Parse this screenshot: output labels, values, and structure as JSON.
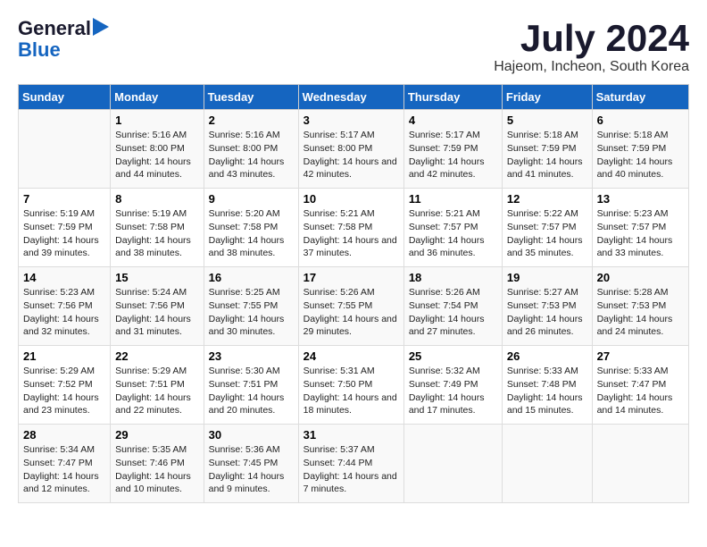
{
  "logo": {
    "line1": "General",
    "line2": "Blue"
  },
  "title": "July 2024",
  "subtitle": "Hajeom, Incheon, South Korea",
  "headers": [
    "Sunday",
    "Monday",
    "Tuesday",
    "Wednesday",
    "Thursday",
    "Friday",
    "Saturday"
  ],
  "weeks": [
    [
      {
        "day": "",
        "sunrise": "",
        "sunset": "",
        "daylight": ""
      },
      {
        "day": "1",
        "sunrise": "Sunrise: 5:16 AM",
        "sunset": "Sunset: 8:00 PM",
        "daylight": "Daylight: 14 hours and 44 minutes."
      },
      {
        "day": "2",
        "sunrise": "Sunrise: 5:16 AM",
        "sunset": "Sunset: 8:00 PM",
        "daylight": "Daylight: 14 hours and 43 minutes."
      },
      {
        "day": "3",
        "sunrise": "Sunrise: 5:17 AM",
        "sunset": "Sunset: 8:00 PM",
        "daylight": "Daylight: 14 hours and 42 minutes."
      },
      {
        "day": "4",
        "sunrise": "Sunrise: 5:17 AM",
        "sunset": "Sunset: 7:59 PM",
        "daylight": "Daylight: 14 hours and 42 minutes."
      },
      {
        "day": "5",
        "sunrise": "Sunrise: 5:18 AM",
        "sunset": "Sunset: 7:59 PM",
        "daylight": "Daylight: 14 hours and 41 minutes."
      },
      {
        "day": "6",
        "sunrise": "Sunrise: 5:18 AM",
        "sunset": "Sunset: 7:59 PM",
        "daylight": "Daylight: 14 hours and 40 minutes."
      }
    ],
    [
      {
        "day": "7",
        "sunrise": "Sunrise: 5:19 AM",
        "sunset": "Sunset: 7:59 PM",
        "daylight": "Daylight: 14 hours and 39 minutes."
      },
      {
        "day": "8",
        "sunrise": "Sunrise: 5:19 AM",
        "sunset": "Sunset: 7:58 PM",
        "daylight": "Daylight: 14 hours and 38 minutes."
      },
      {
        "day": "9",
        "sunrise": "Sunrise: 5:20 AM",
        "sunset": "Sunset: 7:58 PM",
        "daylight": "Daylight: 14 hours and 38 minutes."
      },
      {
        "day": "10",
        "sunrise": "Sunrise: 5:21 AM",
        "sunset": "Sunset: 7:58 PM",
        "daylight": "Daylight: 14 hours and 37 minutes."
      },
      {
        "day": "11",
        "sunrise": "Sunrise: 5:21 AM",
        "sunset": "Sunset: 7:57 PM",
        "daylight": "Daylight: 14 hours and 36 minutes."
      },
      {
        "day": "12",
        "sunrise": "Sunrise: 5:22 AM",
        "sunset": "Sunset: 7:57 PM",
        "daylight": "Daylight: 14 hours and 35 minutes."
      },
      {
        "day": "13",
        "sunrise": "Sunrise: 5:23 AM",
        "sunset": "Sunset: 7:57 PM",
        "daylight": "Daylight: 14 hours and 33 minutes."
      }
    ],
    [
      {
        "day": "14",
        "sunrise": "Sunrise: 5:23 AM",
        "sunset": "Sunset: 7:56 PM",
        "daylight": "Daylight: 14 hours and 32 minutes."
      },
      {
        "day": "15",
        "sunrise": "Sunrise: 5:24 AM",
        "sunset": "Sunset: 7:56 PM",
        "daylight": "Daylight: 14 hours and 31 minutes."
      },
      {
        "day": "16",
        "sunrise": "Sunrise: 5:25 AM",
        "sunset": "Sunset: 7:55 PM",
        "daylight": "Daylight: 14 hours and 30 minutes."
      },
      {
        "day": "17",
        "sunrise": "Sunrise: 5:26 AM",
        "sunset": "Sunset: 7:55 PM",
        "daylight": "Daylight: 14 hours and 29 minutes."
      },
      {
        "day": "18",
        "sunrise": "Sunrise: 5:26 AM",
        "sunset": "Sunset: 7:54 PM",
        "daylight": "Daylight: 14 hours and 27 minutes."
      },
      {
        "day": "19",
        "sunrise": "Sunrise: 5:27 AM",
        "sunset": "Sunset: 7:53 PM",
        "daylight": "Daylight: 14 hours and 26 minutes."
      },
      {
        "day": "20",
        "sunrise": "Sunrise: 5:28 AM",
        "sunset": "Sunset: 7:53 PM",
        "daylight": "Daylight: 14 hours and 24 minutes."
      }
    ],
    [
      {
        "day": "21",
        "sunrise": "Sunrise: 5:29 AM",
        "sunset": "Sunset: 7:52 PM",
        "daylight": "Daylight: 14 hours and 23 minutes."
      },
      {
        "day": "22",
        "sunrise": "Sunrise: 5:29 AM",
        "sunset": "Sunset: 7:51 PM",
        "daylight": "Daylight: 14 hours and 22 minutes."
      },
      {
        "day": "23",
        "sunrise": "Sunrise: 5:30 AM",
        "sunset": "Sunset: 7:51 PM",
        "daylight": "Daylight: 14 hours and 20 minutes."
      },
      {
        "day": "24",
        "sunrise": "Sunrise: 5:31 AM",
        "sunset": "Sunset: 7:50 PM",
        "daylight": "Daylight: 14 hours and 18 minutes."
      },
      {
        "day": "25",
        "sunrise": "Sunrise: 5:32 AM",
        "sunset": "Sunset: 7:49 PM",
        "daylight": "Daylight: 14 hours and 17 minutes."
      },
      {
        "day": "26",
        "sunrise": "Sunrise: 5:33 AM",
        "sunset": "Sunset: 7:48 PM",
        "daylight": "Daylight: 14 hours and 15 minutes."
      },
      {
        "day": "27",
        "sunrise": "Sunrise: 5:33 AM",
        "sunset": "Sunset: 7:47 PM",
        "daylight": "Daylight: 14 hours and 14 minutes."
      }
    ],
    [
      {
        "day": "28",
        "sunrise": "Sunrise: 5:34 AM",
        "sunset": "Sunset: 7:47 PM",
        "daylight": "Daylight: 14 hours and 12 minutes."
      },
      {
        "day": "29",
        "sunrise": "Sunrise: 5:35 AM",
        "sunset": "Sunset: 7:46 PM",
        "daylight": "Daylight: 14 hours and 10 minutes."
      },
      {
        "day": "30",
        "sunrise": "Sunrise: 5:36 AM",
        "sunset": "Sunset: 7:45 PM",
        "daylight": "Daylight: 14 hours and 9 minutes."
      },
      {
        "day": "31",
        "sunrise": "Sunrise: 5:37 AM",
        "sunset": "Sunset: 7:44 PM",
        "daylight": "Daylight: 14 hours and 7 minutes."
      },
      {
        "day": "",
        "sunrise": "",
        "sunset": "",
        "daylight": ""
      },
      {
        "day": "",
        "sunrise": "",
        "sunset": "",
        "daylight": ""
      },
      {
        "day": "",
        "sunrise": "",
        "sunset": "",
        "daylight": ""
      }
    ]
  ]
}
